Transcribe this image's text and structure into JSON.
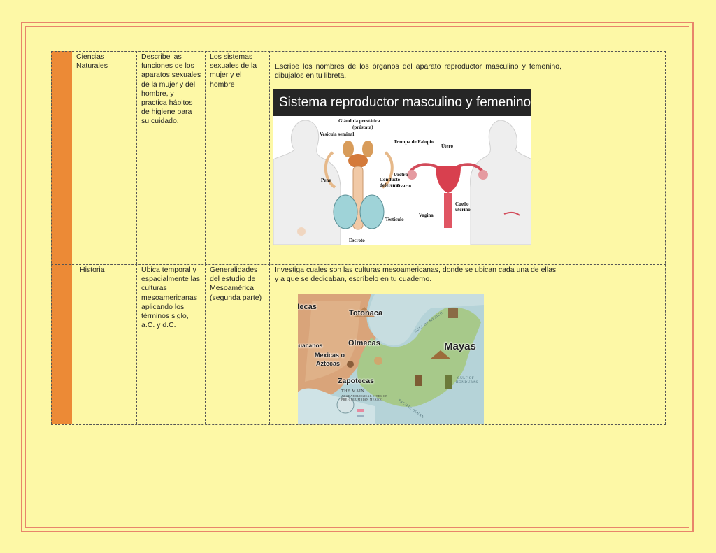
{
  "rows": [
    {
      "subject": "Ciencias Naturales",
      "objective": "Describe las funciones de los aparatos sexuales de la mujer y del hombre, y practica hábitos de higiene para su cuidado.",
      "topic": "Los sistemas sexuales de la mujer y el hombre",
      "activity": "Escribe los nombres de los órganos del aparato reproductor masculino y femenino, dibujalos en tu libreta."
    },
    {
      "subject": "Historia",
      "objective": "Ubica temporal y espacialmente las culturas mesoamericanas aplicando los términos siglo, a.C. y d.C.",
      "topic": "Generalidades del estudio de Mesoamérica (segunda parte)",
      "activity": "Investiga cuales son las culturas mesoamericanas, donde se ubican cada una de ellas y a que se dedicaban, escríbelo en tu cuaderno."
    }
  ],
  "repro_image": {
    "title": "Sistema reproductor masculino y femenino",
    "labels": {
      "glandula": "Glándula prostática",
      "prostata": "(próstata)",
      "vesicula": "Vesícula seminal",
      "pene": "Pene",
      "conducto1": "Conducto",
      "conducto2": "deferente",
      "testiculo": "Testículo",
      "escroto": "Escroto",
      "trompa": "Trompa de Falopio",
      "utero": "Útero",
      "uretra": "Uretra",
      "ovario": "Ovario",
      "cuello1": "Cuello",
      "cuello2": "uterino",
      "vagina": "Vagina"
    }
  },
  "map_image": {
    "labels": {
      "toltecas": "Toltecas",
      "totonaca": "Totonaca",
      "teotihuacanos": "Teotihuacanos",
      "olmecas": "Olmecas",
      "mayas": "Mayas",
      "mexicas1": "Mexicas o",
      "mexicas2": "Aztecas",
      "zapotecas": "Zapotecas",
      "gulf_mexico": "GULF OF MEXICO",
      "gulf_honduras1": "GULF OF",
      "gulf_honduras2": "HONDURAS",
      "pacific": "PACIFIC OCEAN",
      "legend1": "THE MAIN",
      "legend2": "ARCHAEOLOGICAL SITES OF",
      "legend3": "PRE-COLUMBIAN MEXICO"
    }
  },
  "colors": {
    "page_background": "#fdf8a6",
    "frame": "#e8856b",
    "side_bar": "#ec8a36"
  }
}
